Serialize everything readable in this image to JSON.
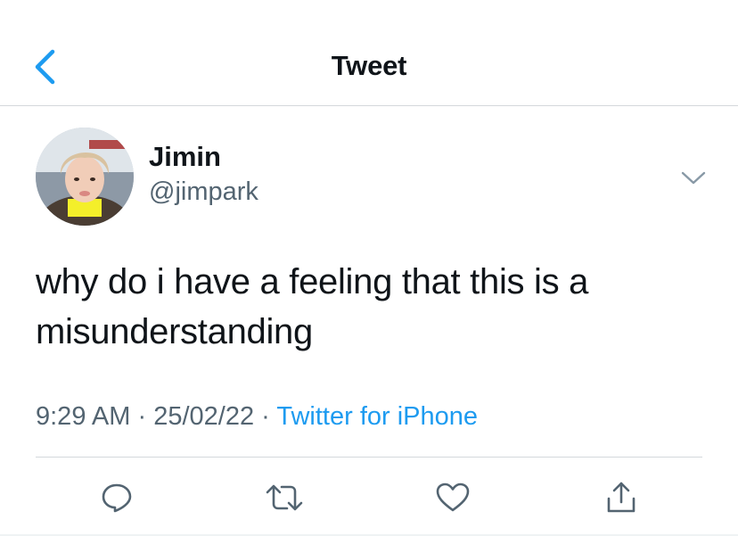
{
  "header": {
    "title": "Tweet",
    "back_icon": "chevron-left-icon",
    "accent_color": "#1d9bf0"
  },
  "author": {
    "display_name": "Jimin",
    "handle": "@jimpark",
    "avatar_icon": "profile-photo",
    "more_icon": "chevron-down-icon"
  },
  "tweet": {
    "text_line1": "why do i have a feeling that this is a",
    "text_line2": "misunderstanding",
    "time": "9:29 AM",
    "separator": "·",
    "date": "25/02/22",
    "source": "Twitter for iPhone"
  },
  "actions": {
    "reply_icon": "reply-icon",
    "retweet_icon": "retweet-icon",
    "like_icon": "heart-icon",
    "share_icon": "share-icon"
  },
  "colors": {
    "text_primary": "#0f1419",
    "text_secondary": "#536471",
    "link": "#1d9bf0",
    "divider": "#d4d8db"
  }
}
